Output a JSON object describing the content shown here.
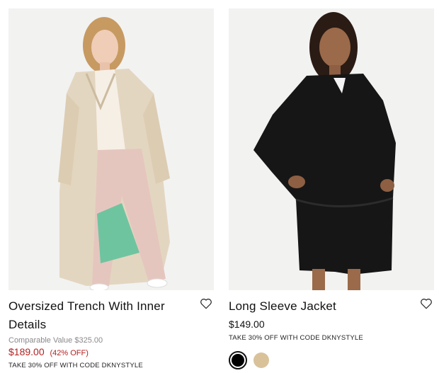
{
  "products": [
    {
      "title": "Oversized Trench With Inner Details",
      "comparable": "Comparable Value $325.00",
      "sale_price": "$189.00",
      "discount": "(42% OFF)",
      "promo": "TAKE 30% OFF WITH CODE DKNYSTYLE",
      "image": "woman-in-beige-trench-coat-photo"
    },
    {
      "title": "Long Sleeve Jacket",
      "price": "$149.00",
      "promo": "TAKE 30% OFF WITH CODE DKNYSTYLE",
      "image": "woman-in-black-jacket-photo",
      "swatches": [
        {
          "color": "#000000",
          "selected": true
        },
        {
          "color": "#d9c29a",
          "selected": false
        }
      ]
    }
  ],
  "colors": {
    "sale": "#b22222",
    "text": "#111111",
    "muted": "#8a8a8a",
    "photo_bg": "#f3f3f3"
  }
}
